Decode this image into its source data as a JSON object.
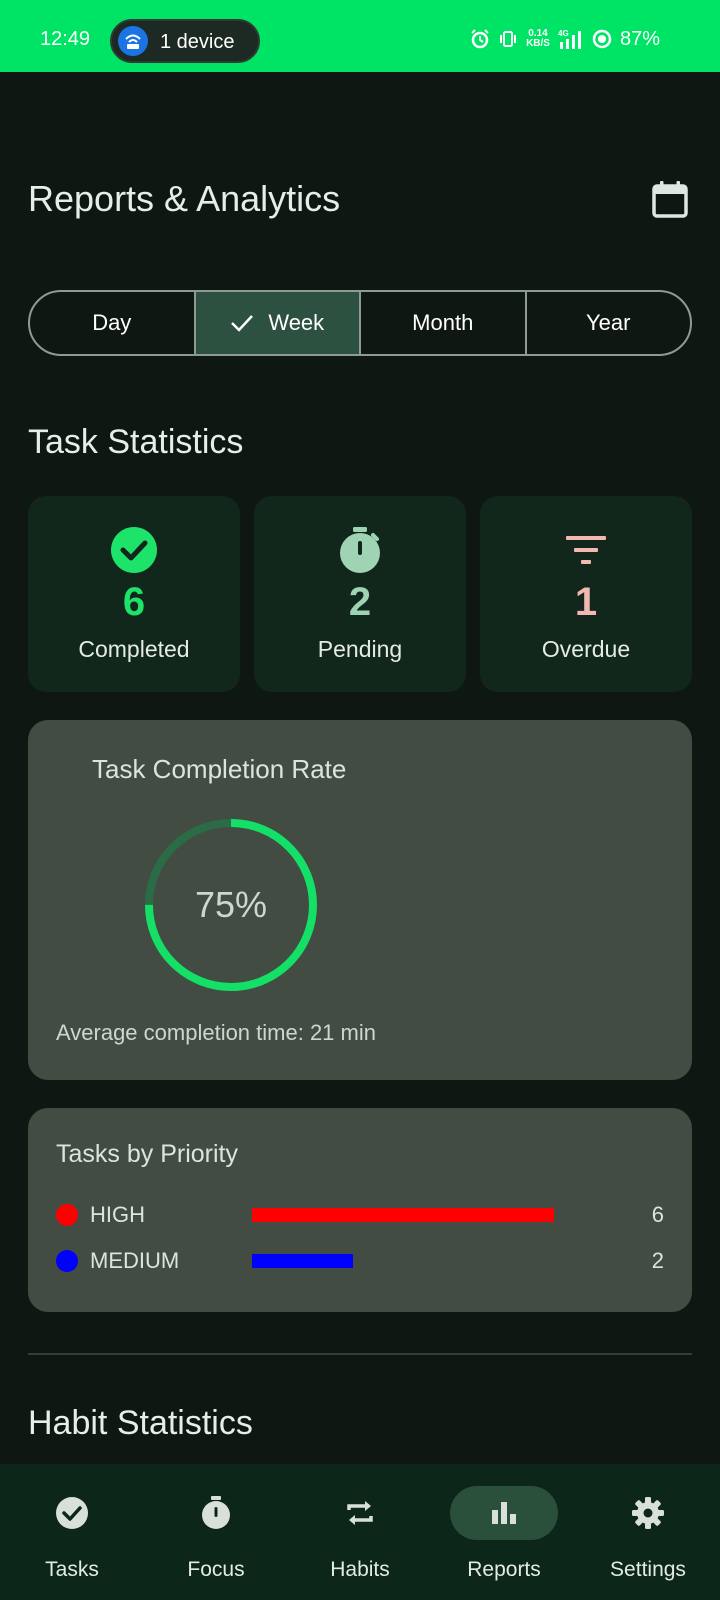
{
  "status_bar": {
    "time": "12:49",
    "hotspot_label": "1 device",
    "speed_top": "0.14",
    "speed_bottom": "KB/S",
    "network": "4G",
    "battery": "87%",
    "background": "#00e466"
  },
  "header": {
    "title": "Reports & Analytics",
    "calendar_icon": "calendar-icon"
  },
  "period_tabs": {
    "items": [
      {
        "label": "Day",
        "selected": false
      },
      {
        "label": "Week",
        "selected": true
      },
      {
        "label": "Month",
        "selected": false
      },
      {
        "label": "Year",
        "selected": false
      }
    ]
  },
  "task_statistics": {
    "title": "Task Statistics",
    "cards": [
      {
        "value": "6",
        "label": "Completed",
        "icon": "check-circle-icon",
        "color": "#1ee36b"
      },
      {
        "value": "2",
        "label": "Pending",
        "icon": "timer-icon",
        "color": "#9fd3b3"
      },
      {
        "value": "1",
        "label": "Overdue",
        "icon": "filter-icon",
        "color": "#f2b8b1"
      }
    ]
  },
  "completion_rate": {
    "title": "Task Completion Rate",
    "percent_text": "75%",
    "percent": 75,
    "average_text": "Average completion time: 21 min",
    "ring_color": "#14e068",
    "track_color": "#2b6b46"
  },
  "priority": {
    "title": "Tasks by Priority",
    "rows": [
      {
        "name": "HIGH",
        "count": "6",
        "value": 6,
        "color": "#ff0000"
      },
      {
        "name": "MEDIUM",
        "count": "2",
        "value": 2,
        "color": "#0000ff"
      }
    ],
    "max": 6
  },
  "habit_statistics": {
    "title": "Habit Statistics"
  },
  "bottom_nav": {
    "items": [
      {
        "label": "Tasks",
        "icon": "check-circle-icon",
        "active": false
      },
      {
        "label": "Focus",
        "icon": "timer-icon",
        "active": false
      },
      {
        "label": "Habits",
        "icon": "repeat-icon",
        "active": false
      },
      {
        "label": "Reports",
        "icon": "bar-chart-icon",
        "active": true
      },
      {
        "label": "Settings",
        "icon": "gear-icon",
        "active": false
      }
    ]
  }
}
